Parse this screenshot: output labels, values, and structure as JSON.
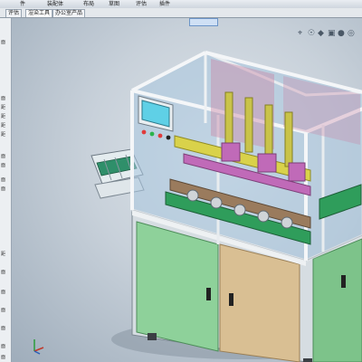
{
  "menu": [
    "件",
    "装配体",
    "布局",
    "草图",
    "评估",
    "插件"
  ],
  "tabs": [
    {
      "label": "评估"
    },
    {
      "label": "渲染工具"
    },
    {
      "label": "办公室产品"
    }
  ],
  "tree_labels": [
    "面",
    "面",
    "距",
    "距",
    "距",
    "距",
    "面",
    "面",
    "面",
    "面",
    "距",
    "面",
    "面",
    "面",
    "面",
    "面",
    "面"
  ],
  "view_tools": [
    "⌖",
    "☉",
    "◆",
    "▣",
    "●",
    "◎",
    "▦",
    "◉",
    "❑"
  ],
  "colors": {
    "frame": "#e8ecef",
    "glass": "#a9c7df",
    "cabinet_green": "#8ed19a",
    "cabinet_tan": "#d9bf93",
    "hmi_screen": "#5fd0e6",
    "magenta_parts": "#c06ab8",
    "yellow_parts": "#d9d24a",
    "green_plates": "#2f9d5b"
  }
}
